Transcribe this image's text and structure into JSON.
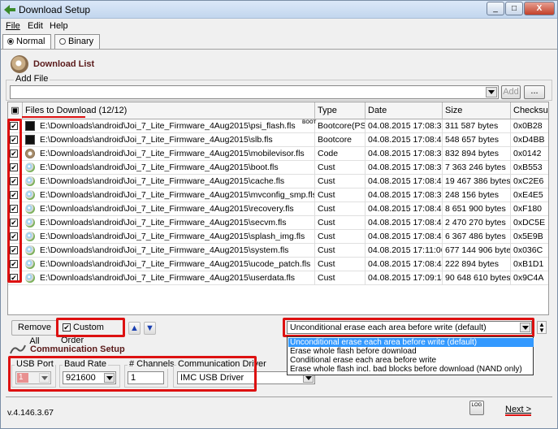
{
  "window": {
    "title": "Download Setup",
    "min": "_",
    "max": "□",
    "close": "X"
  },
  "menu": {
    "file": "File",
    "edit": "Edit",
    "help": "Help"
  },
  "mode": {
    "normal": "Normal",
    "binary": "Binary"
  },
  "download_list": {
    "title": "Download List",
    "add_file_label": "Add File",
    "add_button": "Add",
    "browse_button": "..."
  },
  "table": {
    "headers": {
      "files": "Files to Download (12/12)",
      "type": "Type",
      "date": "Date",
      "size": "Size",
      "checksum": "Checksum"
    },
    "rows": [
      {
        "path": "E:\\Downloads\\android\\Joi_7_Lite_Firmware_4Aug2015\\psi_flash.fls",
        "type": "Bootcore(PSI)",
        "date": "04.08.2015 17:08:38",
        "size": "311 587 bytes",
        "checksum": "0x0B28",
        "icon": "b",
        "badge": "BOOT"
      },
      {
        "path": "E:\\Downloads\\android\\Joi_7_Lite_Firmware_4Aug2015\\slb.fls",
        "type": "Bootcore",
        "date": "04.08.2015 17:08:40",
        "size": "548 657 bytes",
        "checksum": "0xD4BB",
        "icon": "b",
        "badge": ""
      },
      {
        "path": "E:\\Downloads\\android\\Joi_7_Lite_Firmware_4Aug2015\\mobilevisor.fls",
        "type": "Code",
        "date": "04.08.2015 17:08:38",
        "size": "832 894 bytes",
        "checksum": "0x0142",
        "icon": "c",
        "badge": ""
      },
      {
        "path": "E:\\Downloads\\android\\Joi_7_Lite_Firmware_4Aug2015\\boot.fls",
        "type": "Cust",
        "date": "04.08.2015 17:08:36",
        "size": "7 363 246 bytes",
        "checksum": "0xB553",
        "icon": "u",
        "badge": ""
      },
      {
        "path": "E:\\Downloads\\android\\Joi_7_Lite_Firmware_4Aug2015\\cache.fls",
        "type": "Cust",
        "date": "04.08.2015 17:08:40",
        "size": "19 467 386 bytes",
        "checksum": "0xC2E6",
        "icon": "u",
        "badge": ""
      },
      {
        "path": "E:\\Downloads\\android\\Joi_7_Lite_Firmware_4Aug2015\\mvconfig_smp.fls",
        "type": "Cust",
        "date": "04.08.2015 17:08:38",
        "size": "248 156 bytes",
        "checksum": "0xE4E5",
        "icon": "u",
        "badge": ""
      },
      {
        "path": "E:\\Downloads\\android\\Joi_7_Lite_Firmware_4Aug2015\\recovery.fls",
        "type": "Cust",
        "date": "04.08.2015 17:08:40",
        "size": "8 651 900 bytes",
        "checksum": "0xF180",
        "icon": "u",
        "badge": ""
      },
      {
        "path": "E:\\Downloads\\android\\Joi_7_Lite_Firmware_4Aug2015\\secvm.fls",
        "type": "Cust",
        "date": "04.08.2015 17:08:40",
        "size": "2 470 270 bytes",
        "checksum": "0xDC5E",
        "icon": "u",
        "badge": ""
      },
      {
        "path": "E:\\Downloads\\android\\Joi_7_Lite_Firmware_4Aug2015\\splash_img.fls",
        "type": "Cust",
        "date": "04.08.2015 17:08:42",
        "size": "6 367 486 bytes",
        "checksum": "0x5E9B",
        "icon": "u",
        "badge": ""
      },
      {
        "path": "E:\\Downloads\\android\\Joi_7_Lite_Firmware_4Aug2015\\system.fls",
        "type": "Cust",
        "date": "04.08.2015 17:11:06",
        "size": "677 144 906 bytes",
        "checksum": "0x036C",
        "icon": "u",
        "badge": ""
      },
      {
        "path": "E:\\Downloads\\android\\Joi_7_Lite_Firmware_4Aug2015\\ucode_patch.fls",
        "type": "Cust",
        "date": "04.08.2015 17:08:44",
        "size": "222 894 bytes",
        "checksum": "0xB1D1",
        "icon": "u",
        "badge": ""
      },
      {
        "path": "E:\\Downloads\\android\\Joi_7_Lite_Firmware_4Aug2015\\userdata.fls",
        "type": "Cust",
        "date": "04.08.2015 17:09:14",
        "size": "90 648 610 bytes",
        "checksum": "0x9C4A",
        "icon": "u",
        "badge": ""
      }
    ]
  },
  "controls": {
    "remove_all": "Remove All",
    "custom_order": "Custom Order",
    "up": "▲",
    "down": "▼"
  },
  "erase": {
    "selected": "Unconditional erase each area before write (default)",
    "options": [
      "Unconditional erase each area before write (default)",
      "Erase whole flash before download",
      "Conditional erase each area before write",
      "Erase whole flash incl. bad blocks before download (NAND only)"
    ]
  },
  "comm": {
    "title": "Communication Setup",
    "usb_port_label": "USB Port",
    "usb_port_value": "1",
    "baud_label": "Baud Rate",
    "baud_value": "921600",
    "channels_label": "# Channels",
    "channels_value": "1",
    "driver_label": "Communication Driver",
    "driver_value": "IMC USB Driver"
  },
  "footer": {
    "version": "v.4.146.3.67",
    "log_button": "LOG",
    "next_button": "Next >"
  },
  "colors": {
    "highlight": "#dd1111",
    "selection": "#3399ff"
  }
}
